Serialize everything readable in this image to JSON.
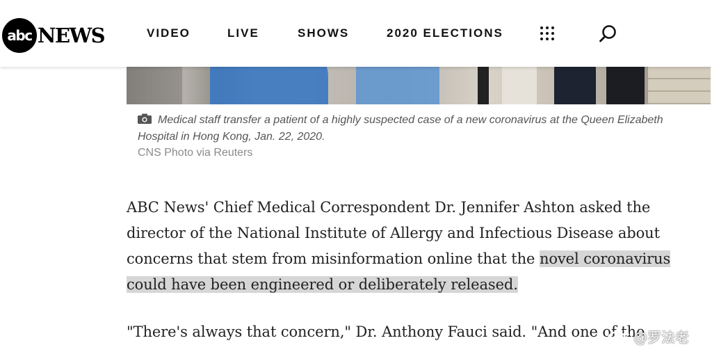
{
  "header": {
    "logo_mark": "abc",
    "logo_word": "NEWS",
    "nav": [
      "VIDEO",
      "LIVE",
      "SHOWS",
      "2020 ELECTIONS"
    ],
    "menu_icon": "grid-dots-icon",
    "search_icon": "search-icon"
  },
  "photo": {
    "caption": "Medical staff transfer a patient of a highly suspected case of a new coronavirus at the Queen Elizabeth Hospital in Hong Kong, Jan. 22, 2020.",
    "credit": "CNS Photo via Reuters",
    "caption_icon": "camera-icon"
  },
  "article": {
    "p1_plain": "ABC News' Chief Medical Correspondent Dr. Jennifer Ashton asked the director of the National Institute of Allergy and Infectious Disease about concerns that stem from misinformation online that the ",
    "p1_highlight": "novel coronavirus could have been engineered or deliberately released.",
    "p2": "\"There's always that concern,\" Dr. Anthony Fauci said. \"And one of the"
  },
  "watermark": {
    "text": "@罗法老",
    "icon": "weibo-icon"
  },
  "colors": {
    "highlight": "#d6d6d6",
    "caption": "#555555",
    "credit": "#8a8a8a"
  }
}
